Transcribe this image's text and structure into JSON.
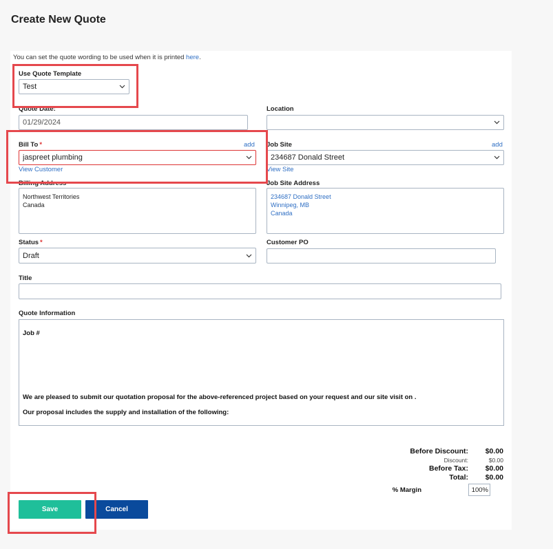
{
  "page": {
    "title": "Create New Quote"
  },
  "intro": {
    "text": "You can set the quote wording to be used when it is printed",
    "link": "here",
    "suffix": "."
  },
  "template": {
    "label": "Use Quote Template",
    "value": "Test"
  },
  "quote_date": {
    "label": "Quote Date:",
    "value": "01/29/2024"
  },
  "location": {
    "label": "Location",
    "value": ""
  },
  "bill_to": {
    "label": "Bill To",
    "required": "*",
    "add": "add",
    "value": "jaspreet plumbing",
    "view": "View Customer"
  },
  "job_site": {
    "label": "Job Site",
    "add": "add",
    "value": "234687 Donald Street",
    "view": "View Site"
  },
  "billing_address": {
    "label": "Billing Address",
    "lines": [
      "Northwest Territories",
      "Canada"
    ]
  },
  "job_site_address": {
    "label": "Job Site Address",
    "lines": [
      "234687 Donald Street",
      "Winnipeg, MB",
      "Canada"
    ]
  },
  "status": {
    "label": "Status",
    "required": "*",
    "value": "Draft"
  },
  "customer_po": {
    "label": "Customer PO",
    "value": ""
  },
  "title_field": {
    "label": "Title",
    "value": ""
  },
  "quote_information": {
    "label": "Quote Information",
    "line1": "Job #",
    "line2": "We are pleased to submit our quotation proposal for the above-referenced project based on your request and our site visit on .",
    "line3": "Our proposal includes the supply and installation of the following:"
  },
  "totals": {
    "before_discount_label": "Before Discount:",
    "before_discount": "$0.00",
    "discount_label": "Discount:",
    "discount": "$0.00",
    "before_tax_label": "Before Tax:",
    "before_tax": "$0.00",
    "total_label": "Total:",
    "total": "$0.00",
    "margin_label": "% Margin",
    "margin": "100%"
  },
  "buttons": {
    "save": "Save",
    "cancel": "Cancel"
  },
  "colors": {
    "primary_save": "#1fbf9a",
    "primary_cancel": "#0a4a9c",
    "link": "#2f6fc4",
    "highlight": "#e5484d"
  }
}
